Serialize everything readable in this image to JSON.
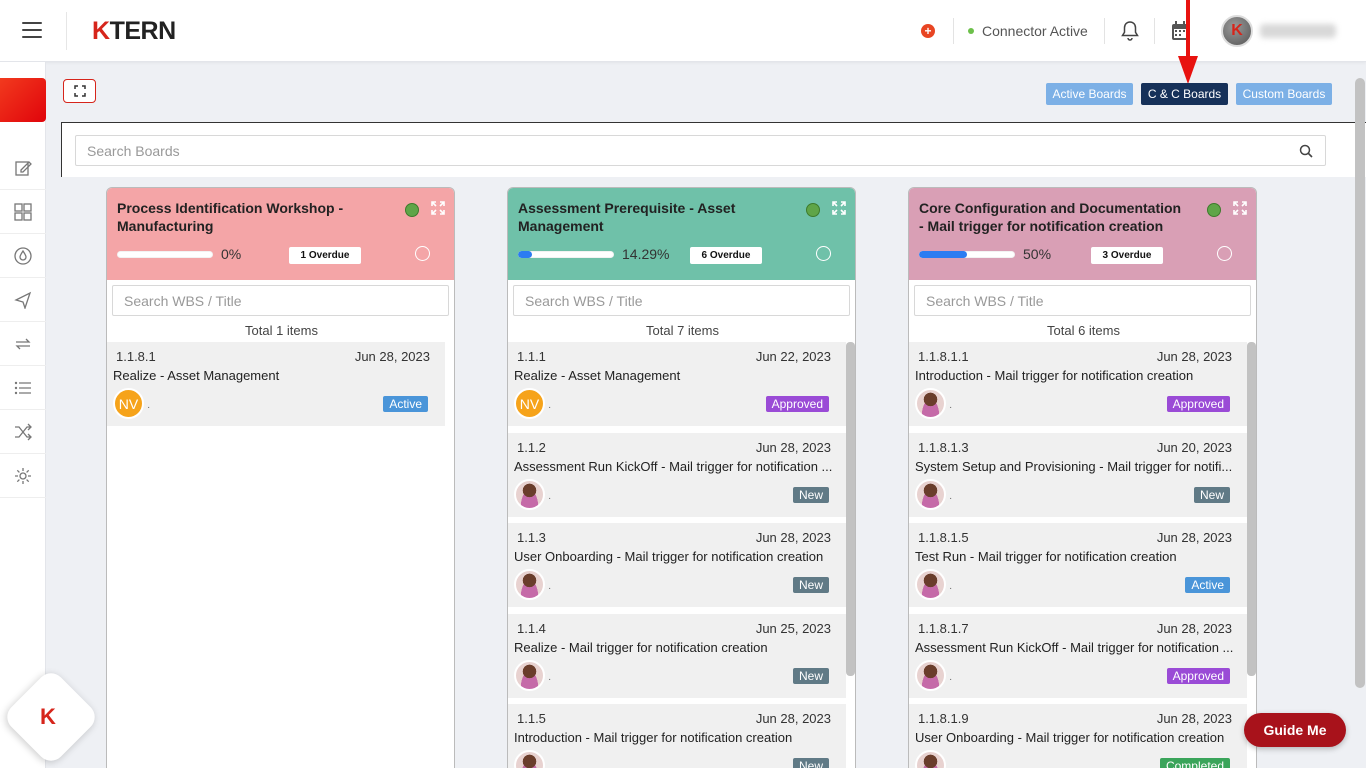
{
  "header": {
    "logo_prefix": "K",
    "logo_rest": "TERN",
    "plus_symbol": "+",
    "connector_status": "Connector Active"
  },
  "icons": [
    "menu-icon",
    "plus-icon",
    "bell-icon",
    "calendar-icon",
    "edit-icon",
    "grid-icon",
    "drop-icon",
    "send-icon",
    "sync-icon",
    "list-icon",
    "shuffle-icon",
    "gear-icon",
    "search-icon",
    "fullscreen-icon",
    "expand-icon"
  ],
  "tabs": {
    "active_boards": "Active Boards",
    "cc_boards": "C & C Boards",
    "custom_boards": "Custom Boards"
  },
  "search": {
    "placeholder": "Search Boards"
  },
  "boards": [
    {
      "title": "Process Identification Workshop - Manufacturing",
      "progress_pct": "0%",
      "progress_value": 0,
      "overdue": "1 Overdue",
      "wbs_placeholder": "Search WBS / Title",
      "total": "Total 1 items",
      "color": "#f4a5a7",
      "items": [
        {
          "wbs": "1.1.8.1",
          "date": "Jun 28, 2023",
          "title": "Realize - Asset Management",
          "avatar": "NV",
          "dot": "·",
          "status": "Active"
        }
      ]
    },
    {
      "title": "Assessment Prerequisite - Asset Management",
      "progress_pct": "14.29%",
      "progress_value": 0.1429,
      "overdue": "6 Overdue",
      "wbs_placeholder": "Search WBS / Title",
      "total": "Total 7 items",
      "color": "#6fc1a9",
      "items": [
        {
          "wbs": "1.1.1",
          "date": "Jun 22, 2023",
          "title": "Realize - Asset Management",
          "avatar": "NV",
          "dot": "·",
          "status": "Approved"
        },
        {
          "wbs": "1.1.2",
          "date": "Jun 28, 2023",
          "title": "Assessment Run KickOff - Mail trigger for notification ...",
          "avatar": "",
          "dot": "·",
          "status": "New"
        },
        {
          "wbs": "1.1.3",
          "date": "Jun 28, 2023",
          "title": "User Onboarding - Mail trigger for notification creation",
          "avatar": "",
          "dot": "·",
          "status": "New"
        },
        {
          "wbs": "1.1.4",
          "date": "Jun 25, 2023",
          "title": "Realize - Mail trigger for notification creation",
          "avatar": "",
          "dot": "·",
          "status": "New"
        },
        {
          "wbs": "1.1.5",
          "date": "Jun 28, 2023",
          "title": "Introduction - Mail trigger for notification creation",
          "avatar": "",
          "dot": "·",
          "status": "New"
        }
      ]
    },
    {
      "title": "Core Configuration and Documentation - Mail trigger for notification creation",
      "progress_pct": "50%",
      "progress_value": 0.5,
      "overdue": "3 Overdue",
      "wbs_placeholder": "Search WBS / Title",
      "total": "Total 6 items",
      "color": "#d99fb5",
      "items": [
        {
          "wbs": "1.1.8.1.1",
          "date": "Jun 28, 2023",
          "title": "Introduction - Mail trigger for notification creation",
          "avatar": "",
          "dot": "·",
          "status": "Approved"
        },
        {
          "wbs": "1.1.8.1.3",
          "date": "Jun 20, 2023",
          "title": "System Setup and Provisioning - Mail trigger for notifi...",
          "avatar": "",
          "dot": "·",
          "status": "New"
        },
        {
          "wbs": "1.1.8.1.5",
          "date": "Jun 28, 2023",
          "title": "Test Run - Mail trigger for notification creation",
          "avatar": "",
          "dot": "·",
          "status": "Active"
        },
        {
          "wbs": "1.1.8.1.7",
          "date": "Jun 28, 2023",
          "title": "Assessment Run KickOff - Mail trigger for notification ...",
          "avatar": "",
          "dot": "·",
          "status": "Approved"
        },
        {
          "wbs": "1.1.8.1.9",
          "date": "Jun 28, 2023",
          "title": "User Onboarding - Mail trigger for notification creation",
          "avatar": "",
          "dot": "·",
          "status": "Completed"
        }
      ]
    }
  ],
  "guide": {
    "label": "Guide Me",
    "fab_logo": "K"
  },
  "colors": {
    "brand": "#d6251b",
    "active_tab": "#163159",
    "inactive_tab": "#7cb0e6",
    "status_active": "#4a95d9",
    "status_approved": "#9a4bd6",
    "status_new": "#607a86",
    "status_completed": "#3aa45a"
  }
}
